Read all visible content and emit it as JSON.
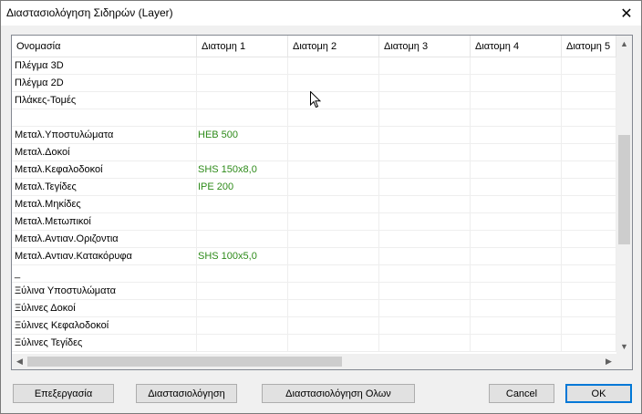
{
  "window": {
    "title": "Διαστασιολόγηση Σιδηρών (Layer)",
    "close_glyph": "✕"
  },
  "grid": {
    "columns": [
      "Ονομασία",
      "Διατομη 1",
      "Διατομη 2",
      "Διατομη 3",
      "Διατομη 4",
      "Διατομη 5"
    ],
    "rows": [
      {
        "name": "Πλέγμα 3D",
        "value": ""
      },
      {
        "name": "Πλέγμα 2D",
        "value": ""
      },
      {
        "name": "Πλάκες-Τομές",
        "value": ""
      },
      {
        "name": "",
        "value": ""
      },
      {
        "name": "Μεταλ.Υποστυλώματα",
        "value": "HEB 500"
      },
      {
        "name": "Μεταλ.Δοκοί",
        "value": ""
      },
      {
        "name": "Μεταλ.Κεφαλοδοκοί",
        "value": "SHS 150x8,0"
      },
      {
        "name": "Μεταλ.Τεγίδες",
        "value": "IPE 200"
      },
      {
        "name": "Μεταλ.Μηκίδες",
        "value": ""
      },
      {
        "name": "Μεταλ.Μετωπικοί",
        "value": ""
      },
      {
        "name": "Μεταλ.Αντιαν.Οριζοντια",
        "value": ""
      },
      {
        "name": "Μεταλ.Αντιαν.Κατακόρυφα",
        "value": "SHS 100x5,0"
      },
      {
        "name": "_",
        "value": ""
      },
      {
        "name": "Ξύλινα Υποστυλώματα",
        "value": ""
      },
      {
        "name": "Ξύλινες Δοκοί",
        "value": ""
      },
      {
        "name": "Ξύλινες Κεφαλοδοκοί",
        "value": ""
      },
      {
        "name": "Ξύλινες Τεγίδες",
        "value": ""
      }
    ],
    "value_color": "#2e8b1a"
  },
  "buttons": {
    "edit": "Επεξεργασία",
    "dimension": "Διαστασιολόγηση",
    "dimension_all": "Διαστασιολόγηση Ολων",
    "cancel": "Cancel",
    "ok": "OK"
  },
  "colors": {
    "accent": "#0078d7",
    "background": "#f0f0f0"
  }
}
